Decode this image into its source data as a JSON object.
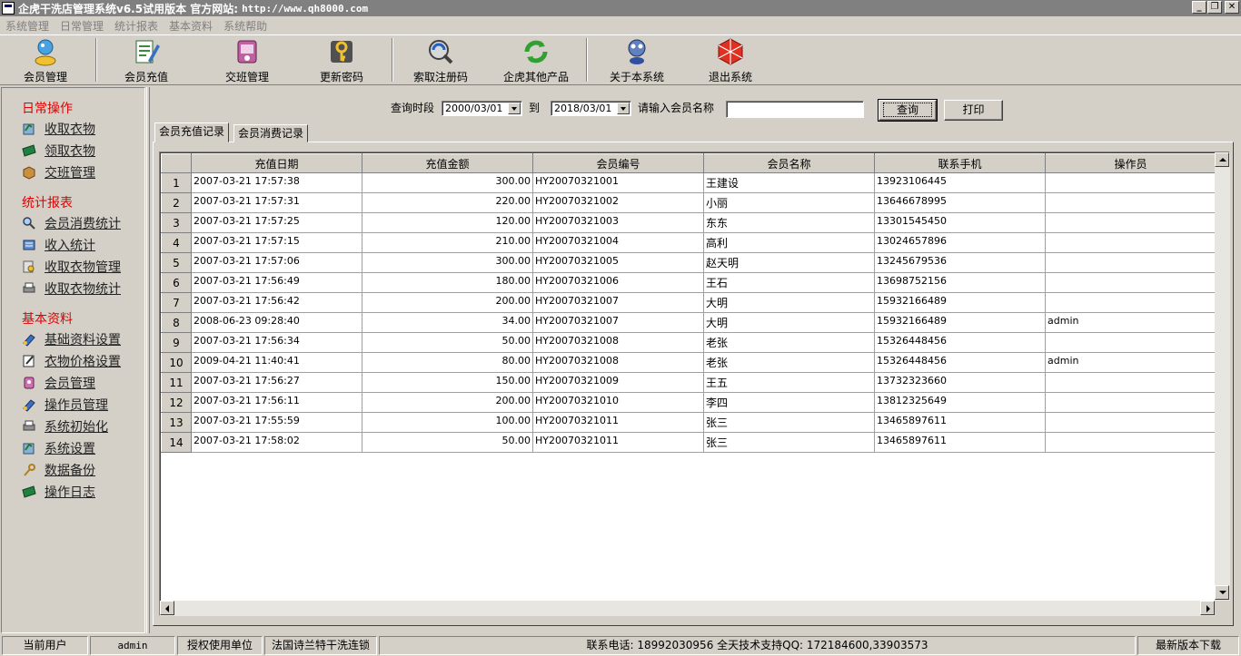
{
  "window": {
    "title": "企虎干洗店管理系统v6.5试用版本 官方网站:",
    "url": "http://www.qh8000.com"
  },
  "menu": [
    "系统管理",
    "日常管理",
    "统计报表",
    "基本资料",
    "系统帮助"
  ],
  "toolbar": {
    "member_manage": "会员管理",
    "member_recharge": "会员充值",
    "shift_manage": "交班管理",
    "change_password": "更新密码",
    "get_reg_code": "索取注册码",
    "other_products": "企虎其他产品",
    "about": "关于本系统",
    "exit": "退出系统"
  },
  "sidebar": {
    "groups": [
      {
        "title": "日常操作",
        "items": [
          "收取衣物",
          "领取衣物",
          "交班管理"
        ]
      },
      {
        "title": "统计报表",
        "items": [
          "会员消费统计",
          "收入统计",
          "收取衣物管理",
          "收取衣物统计"
        ]
      },
      {
        "title": "基本资料",
        "items": [
          "基础资料设置",
          "衣物价格设置",
          "会员管理",
          "操作员管理",
          "系统初始化",
          "系统设置",
          "数据备份",
          "操作日志"
        ]
      }
    ]
  },
  "query": {
    "period_label": "查询时段",
    "start_date": "2000/03/01",
    "to_label": "到",
    "end_date": "2018/03/01",
    "name_label": "请输入会员名称",
    "name_value": "",
    "search_button": "查询",
    "print_button": "打印"
  },
  "tabs": [
    "会员充值记录",
    "会员消费记录"
  ],
  "grid": {
    "columns": [
      "充值日期",
      "充值金额",
      "会员编号",
      "会员名称",
      "联系手机",
      "操作员"
    ],
    "rows": [
      [
        "1",
        "2007-03-21 17:57:38",
        "300.00",
        "HY20070321001",
        "王建设",
        "13923106445",
        ""
      ],
      [
        "2",
        "2007-03-21 17:57:31",
        "220.00",
        "HY20070321002",
        "小丽",
        "13646678995",
        ""
      ],
      [
        "3",
        "2007-03-21 17:57:25",
        "120.00",
        "HY20070321003",
        "东东",
        "13301545450",
        ""
      ],
      [
        "4",
        "2007-03-21 17:57:15",
        "210.00",
        "HY20070321004",
        "高利",
        "13024657896",
        ""
      ],
      [
        "5",
        "2007-03-21 17:57:06",
        "300.00",
        "HY20070321005",
        "赵天明",
        "13245679536",
        ""
      ],
      [
        "6",
        "2007-03-21 17:56:49",
        "180.00",
        "HY20070321006",
        "王石",
        "13698752156",
        ""
      ],
      [
        "7",
        "2007-03-21 17:56:42",
        "200.00",
        "HY20070321007",
        "大明",
        "15932166489",
        ""
      ],
      [
        "8",
        "2008-06-23 09:28:40",
        "34.00",
        "HY20070321007",
        "大明",
        "15932166489",
        "admin"
      ],
      [
        "9",
        "2007-03-21 17:56:34",
        "50.00",
        "HY20070321008",
        "老张",
        "15326448456",
        ""
      ],
      [
        "10",
        "2009-04-21 11:40:41",
        "80.00",
        "HY20070321008",
        "老张",
        "15326448456",
        "admin"
      ],
      [
        "11",
        "2007-03-21 17:56:27",
        "150.00",
        "HY20070321009",
        "王五",
        "13732323660",
        ""
      ],
      [
        "12",
        "2007-03-21 17:56:11",
        "200.00",
        "HY20070321010",
        "李四",
        "13812325649",
        ""
      ],
      [
        "13",
        "2007-03-21 17:55:59",
        "100.00",
        "HY20070321011",
        "张三",
        "13465897611",
        ""
      ],
      [
        "14",
        "2007-03-21 17:58:02",
        "50.00",
        "HY20070321011",
        "张三",
        "13465897611",
        ""
      ]
    ]
  },
  "status": {
    "current_user_label": "当前用户",
    "current_user": "admin",
    "licensed_label": "授权使用单位",
    "licensed_unit": "法国诗兰特干洗连锁",
    "contact": "联系电话: 18992030956  全天技术支持QQ: 172184600,33903573",
    "download": "最新版本下载"
  }
}
